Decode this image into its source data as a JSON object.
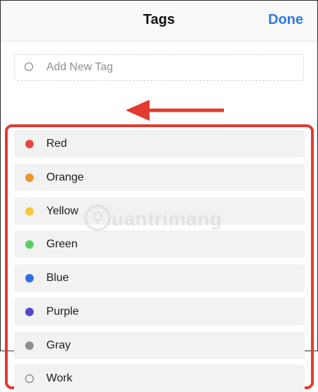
{
  "header": {
    "title": "Tags",
    "done_label": "Done"
  },
  "add_tag": {
    "label": "Add New Tag"
  },
  "tags": [
    {
      "label": "Red",
      "color": "#e8453c"
    },
    {
      "label": "Orange",
      "color": "#f0932b"
    },
    {
      "label": "Yellow",
      "color": "#f5c83a"
    },
    {
      "label": "Green",
      "color": "#5bcf5e"
    },
    {
      "label": "Blue",
      "color": "#2f6fe6"
    },
    {
      "label": "Purple",
      "color": "#5446c9"
    },
    {
      "label": "Gray",
      "color": "#8e8e93"
    },
    {
      "label": "Work",
      "color": "hollow"
    }
  ],
  "annotation": {
    "highlight_color": "#e23a2e"
  },
  "watermark": {
    "text": "uantrimang"
  }
}
